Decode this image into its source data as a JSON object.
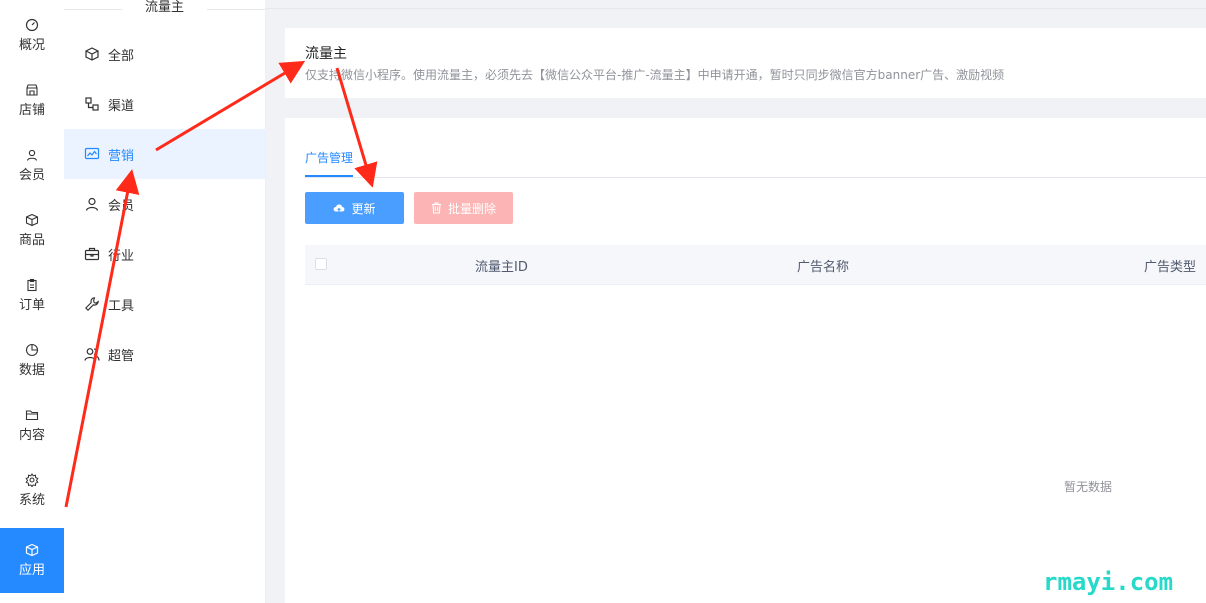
{
  "rail": {
    "items": [
      {
        "label": "概况",
        "icon": "gauge-icon"
      },
      {
        "label": "店铺",
        "icon": "store-icon"
      },
      {
        "label": "会员",
        "icon": "user-icon"
      },
      {
        "label": "商品",
        "icon": "box-icon"
      },
      {
        "label": "订单",
        "icon": "clipboard-icon"
      },
      {
        "label": "数据",
        "icon": "pie-chart-icon"
      },
      {
        "label": "内容",
        "icon": "folder-icon"
      },
      {
        "label": "系统",
        "icon": "gear-icon"
      },
      {
        "label": "应用",
        "icon": "cube-icon",
        "active": true
      }
    ]
  },
  "subnav": {
    "title": "流量主",
    "items": [
      {
        "label": "全部",
        "icon": "cube-icon"
      },
      {
        "label": "渠道",
        "icon": "channel-icon"
      },
      {
        "label": "营销",
        "icon": "trend-chart-icon",
        "active": true
      },
      {
        "label": "会员",
        "icon": "user-icon"
      },
      {
        "label": "行业",
        "icon": "briefcase-icon"
      },
      {
        "label": "工具",
        "icon": "wrench-icon"
      },
      {
        "label": "超管",
        "icon": "users-icon"
      }
    ]
  },
  "header": {
    "title": "流量主",
    "description": "仅支持微信小程序。使用流量主，必须先去【微信公众平台-推广-流量主】中申请开通，暂时只同步微信官方banner广告、激励视频"
  },
  "tabs": [
    {
      "label": "广告管理",
      "active": true
    }
  ],
  "toolbar": {
    "update_label": "更新",
    "batch_delete_label": "批量删除"
  },
  "table": {
    "columns": [
      "流量主ID",
      "广告名称",
      "广告类型"
    ],
    "empty_text": "暂无数据"
  },
  "watermark": "rmayi.com",
  "colors": {
    "primary": "#2589ff",
    "danger_disabled": "#fcb4b4",
    "annotation_arrow": "#ff2a1a",
    "watermark": "#26d9c8"
  }
}
